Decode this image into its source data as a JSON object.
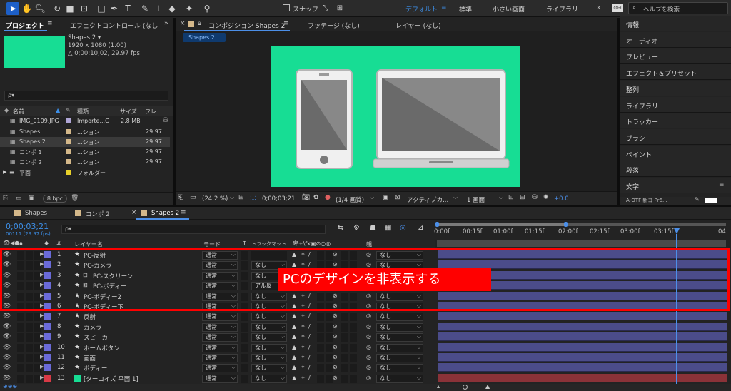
{
  "toolbar": {
    "snap_label": "スナップ",
    "workspaces": [
      "デフォルト",
      "標準",
      "小さい画面",
      "ライブラリ"
    ],
    "search_placeholder": "ヘルプを検索"
  },
  "project_panel": {
    "tab_project": "プロジェクト",
    "tab_effect": "エフェクトコントロール (なし",
    "item_name": "Shapes 2 ▾",
    "item_dims": "1920 x 1080 (1.00)",
    "item_duration": "△ 0;00;10;02, 29.97 fps",
    "search_placeholder": "ρ▾",
    "columns": [
      "名前",
      "種類",
      "サイズ",
      "フレ..."
    ],
    "rows": [
      {
        "name": "IMG_0109.JPG",
        "type": "Importe...G",
        "size": "2.8 MB",
        "fps": ""
      },
      {
        "name": "Shapes",
        "type": "...ション",
        "size": "",
        "fps": "29.97"
      },
      {
        "name": "Shapes 2",
        "type": "...ション",
        "size": "",
        "fps": "29.97"
      },
      {
        "name": "コンポ 1",
        "type": "...ション",
        "size": "",
        "fps": "29.97"
      },
      {
        "name": "コンポ 2",
        "type": "...ション",
        "size": "",
        "fps": "29.97"
      },
      {
        "name": "平面",
        "type": "フォルダー",
        "size": "",
        "fps": ""
      }
    ],
    "bpc": "8 bpc"
  },
  "comp_panel": {
    "tab_comp": "コンポジション Shapes 2",
    "tab_footage": "フッテージ (なし)",
    "tab_layer": "レイヤー (なし)",
    "breadcrumb": "Shapes 2",
    "zoom": "(24.2 %)",
    "timecode": "0;00;03;21",
    "resolution": "(1/4 画質)",
    "camera": "アクティブカ...",
    "view": "1 画面",
    "exposure": "+0.0",
    "bg_color": "#17dd94"
  },
  "right_panel": {
    "items": [
      "情報",
      "オーディオ",
      "プレビュー",
      "エフェクト＆プリセット",
      "整列",
      "ライブラリ",
      "トラッカー",
      "ブラシ",
      "ペイント",
      "段落",
      "文字"
    ]
  },
  "timeline": {
    "tabs": [
      "Shapes",
      "コンポ 2",
      "Shapes 2"
    ],
    "timecode": "0;00;03;21",
    "frame_info": "00111 (29.97 fps)",
    "search_placeholder": "ρ▾",
    "columns": {
      "num": "#",
      "name": "レイヤー名",
      "mode": "モード",
      "t": "T",
      "trkmat": "トラックマット",
      "switches": "卑✧\\fx▣⊘○◎",
      "parent": "親"
    },
    "ruler": [
      "0:00f",
      "00:15f",
      "01:00f",
      "01:15f",
      "02:00f",
      "02:15f",
      "03:00f",
      "03:15f",
      "04"
    ],
    "layers": [
      {
        "num": "1",
        "name": "PC-反射",
        "mode": "通常",
        "trkmat": "",
        "parent": "なし",
        "color": "#6a6ad8"
      },
      {
        "num": "2",
        "name": "PC-カメラ",
        "mode": "通常",
        "trkmat": "なし",
        "parent": "なし",
        "color": "#6a6ad8"
      },
      {
        "num": "3",
        "name": "PC-スクリーン",
        "mode": "通常",
        "trkmat": "なし",
        "parent": "なし",
        "color": "#6a6ad8"
      },
      {
        "num": "4",
        "name": "PC-ボディー",
        "mode": "通常",
        "trkmat": "アル反",
        "parent": "なし",
        "color": "#6a6ad8"
      },
      {
        "num": "5",
        "name": "PC-ボディー2",
        "mode": "通常",
        "trkmat": "なし",
        "parent": "なし",
        "color": "#6a6ad8"
      },
      {
        "num": "6",
        "name": "PC-ボディー下",
        "mode": "通常",
        "trkmat": "なし",
        "parent": "なし",
        "color": "#6a6ad8"
      },
      {
        "num": "7",
        "name": "反射",
        "mode": "通常",
        "trkmat": "なし",
        "parent": "なし",
        "color": "#6a6ad8"
      },
      {
        "num": "8",
        "name": "カメラ",
        "mode": "通常",
        "trkmat": "なし",
        "parent": "なし",
        "color": "#6a6ad8"
      },
      {
        "num": "9",
        "name": "スピーカー",
        "mode": "通常",
        "trkmat": "なし",
        "parent": "なし",
        "color": "#6a6ad8"
      },
      {
        "num": "10",
        "name": "ホームボタン",
        "mode": "通常",
        "trkmat": "なし",
        "parent": "なし",
        "color": "#6a6ad8"
      },
      {
        "num": "11",
        "name": "画面",
        "mode": "通常",
        "trkmat": "なし",
        "parent": "なし",
        "color": "#6a6ad8"
      },
      {
        "num": "12",
        "name": "ボディー",
        "mode": "通常",
        "trkmat": "なし",
        "parent": "なし",
        "color": "#6a6ad8"
      },
      {
        "num": "13",
        "name": "[ターコイズ 平面 1]",
        "mode": "通常",
        "trkmat": "なし",
        "parent": "なし",
        "color": "#d83a46"
      }
    ]
  },
  "annotation": {
    "text": "PCのデザインを非表示する",
    "color": "#ff0000"
  }
}
